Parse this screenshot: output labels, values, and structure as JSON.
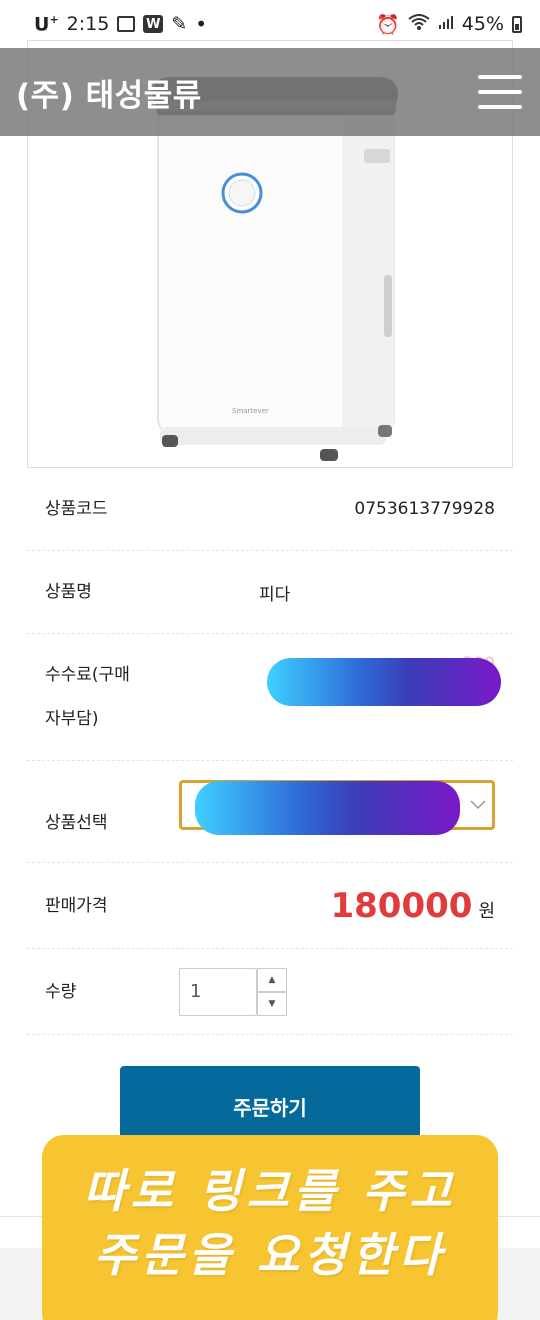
{
  "status_bar": {
    "carrier": "U",
    "time": "2:15",
    "battery": "45%"
  },
  "header": {
    "brand": "(주) 태성물류"
  },
  "product": {
    "code_label": "상품코드",
    "code_value": "0753613779928",
    "name_label": "상품명",
    "name_value_visible": "피다",
    "fee_label_line1": "수수료(구매",
    "fee_label_line2": "자부담)",
    "fee_value": "500",
    "select_label": "상품선택",
    "price_label": "판매가격",
    "price_value": "180000",
    "price_unit": "원",
    "qty_label": "수량",
    "qty_value": "1"
  },
  "order_button": {
    "label": "주문하기"
  },
  "caption": {
    "line1": "따로 링크를 주고",
    "line2": "주문을 요청한다"
  },
  "colors": {
    "accent_button": "#06699b",
    "price_red": "#e13c3c",
    "caption_yellow": "#f7c531",
    "select_border": "#d9a230"
  }
}
